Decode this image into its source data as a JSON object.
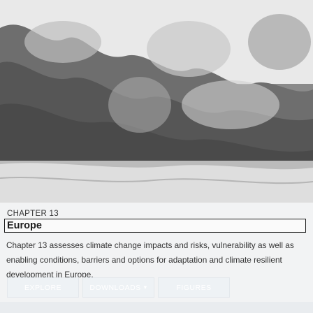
{
  "chapter": {
    "label": "CHAPTER 13",
    "title": "Europe",
    "description": "Chapter 13 assesses climate change impacts and risks, vulnerability as well as enabling conditions, barriers and options for adaptation and climate resilient development in Europe."
  },
  "buttons": {
    "explore": "EXPLORE",
    "downloads": "DOWNLOADS",
    "downloads_chevron": "▾",
    "figures": "FIGURES"
  },
  "colors": {
    "border": "#1a1a1a",
    "button_bg": "#eef2f5"
  }
}
